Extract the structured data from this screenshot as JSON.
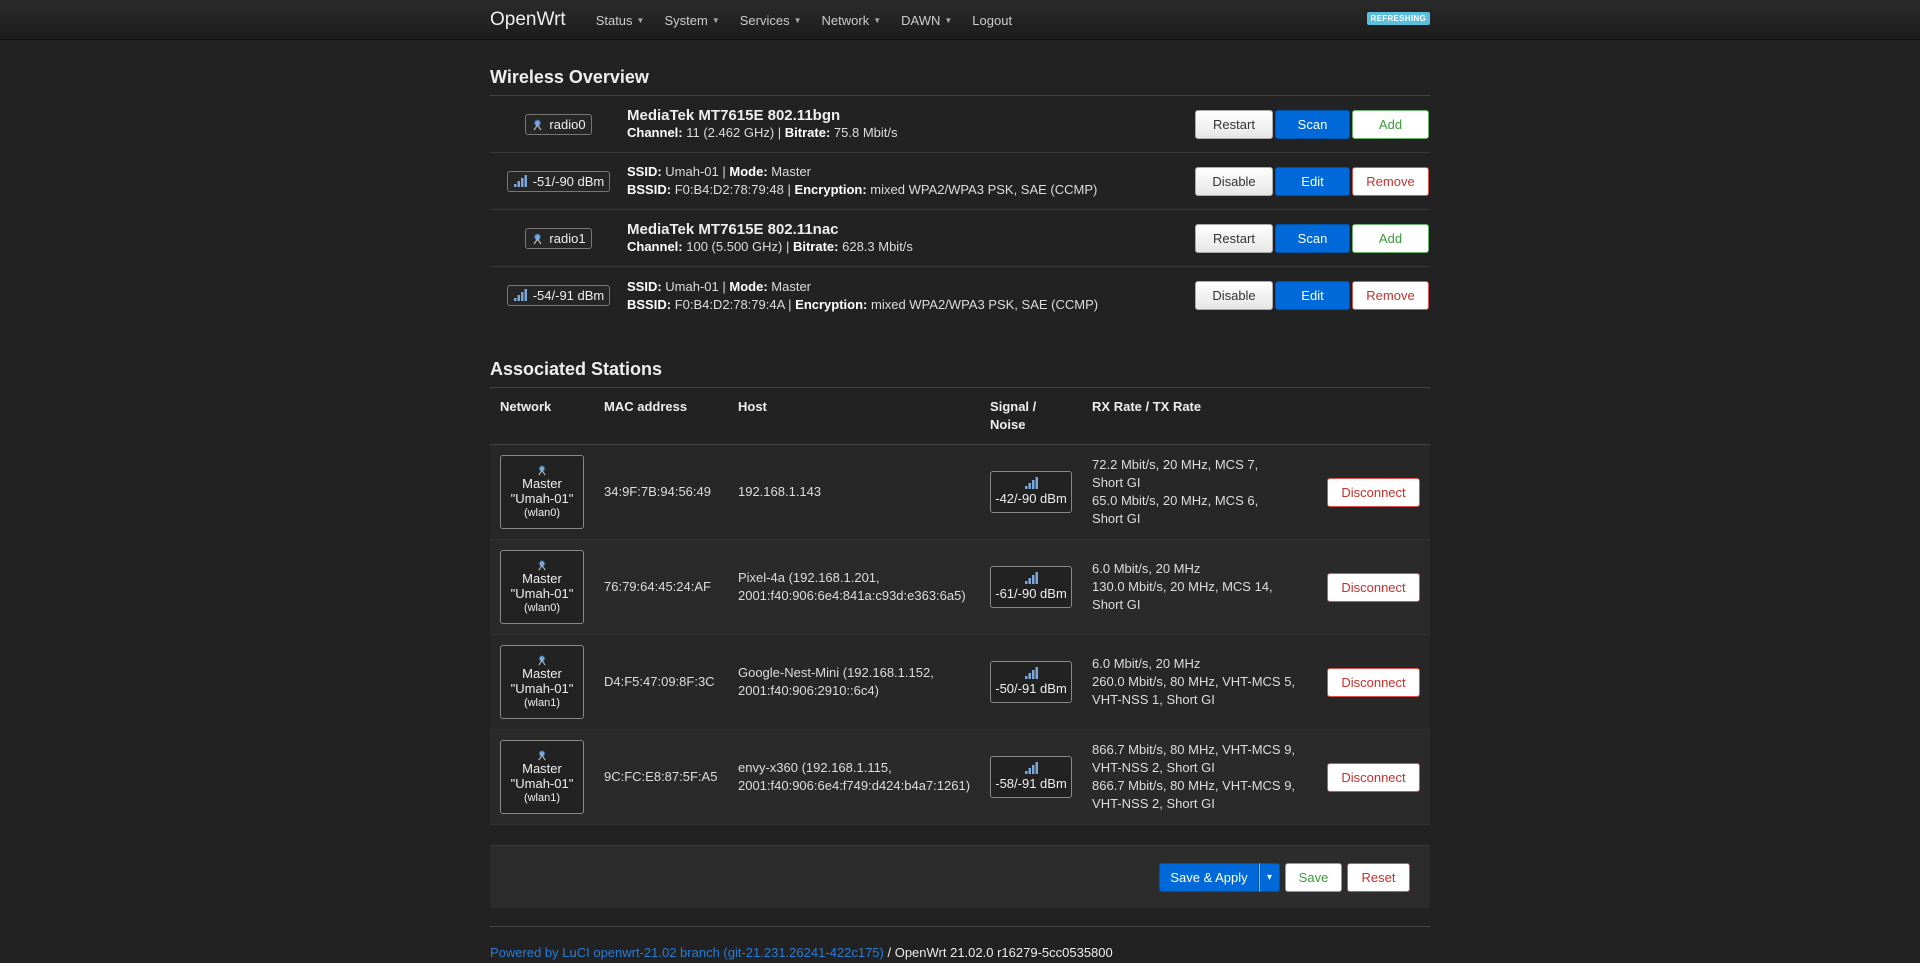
{
  "nav": {
    "brand": "OpenWrt",
    "menu": [
      {
        "label": "Status",
        "caret": true
      },
      {
        "label": "System",
        "caret": true
      },
      {
        "label": "Services",
        "caret": true
      },
      {
        "label": "Network",
        "caret": true
      },
      {
        "label": "DAWN",
        "caret": true
      },
      {
        "label": "Logout",
        "caret": false
      }
    ],
    "badge": "REFRESHING"
  },
  "wireless": {
    "title": "Wireless Overview",
    "radios": [
      {
        "device": {
          "chip": "radio0",
          "title": "MediaTek MT7615E 802.11bgn",
          "channel_label": "Channel:",
          "channel": "11 (2.462 GHz)",
          "sep": " | ",
          "bitrate_label": "Bitrate:",
          "bitrate": "75.8 Mbit/s",
          "buttons": [
            "Restart",
            "Scan",
            "Add"
          ]
        },
        "iface": {
          "chip": "-51/-90 dBm",
          "ssid_label": "SSID:",
          "ssid": "Umah-01",
          "mode_label": "Mode:",
          "mode": "Master",
          "bssid_label": "BSSID:",
          "bssid": "F0:B4:D2:78:79:48",
          "enc_label": "Encryption:",
          "enc": "mixed WPA2/WPA3 PSK, SAE (CCMP)",
          "buttons": [
            "Disable",
            "Edit",
            "Remove"
          ]
        }
      },
      {
        "device": {
          "chip": "radio1",
          "title": "MediaTek MT7615E 802.11nac",
          "channel_label": "Channel:",
          "channel": "100 (5.500 GHz)",
          "sep": " | ",
          "bitrate_label": "Bitrate:",
          "bitrate": "628.3 Mbit/s",
          "buttons": [
            "Restart",
            "Scan",
            "Add"
          ]
        },
        "iface": {
          "chip": "-54/-91 dBm",
          "ssid_label": "SSID:",
          "ssid": "Umah-01",
          "mode_label": "Mode:",
          "mode": "Master",
          "bssid_label": "BSSID:",
          "bssid": "F0:B4:D2:78:79:4A",
          "enc_label": "Encryption:",
          "enc": "mixed WPA2/WPA3 PSK, SAE (CCMP)",
          "buttons": [
            "Disable",
            "Edit",
            "Remove"
          ]
        }
      }
    ]
  },
  "stations": {
    "title": "Associated Stations",
    "columns": [
      "Network",
      "MAC address",
      "Host",
      "Signal /",
      "Noise",
      "RX Rate / TX Rate"
    ],
    "rows": [
      {
        "mode": "Master",
        "ssid": "\"Umah-01\"",
        "iface": "(wlan0)",
        "mac": "34:9F:7B:94:56:49",
        "host1": "192.168.1.143",
        "host2": "",
        "signal": "-42/-90 dBm",
        "rate": [
          "72.2 Mbit/s, 20 MHz, MCS 7,",
          "Short GI",
          "65.0 Mbit/s, 20 MHz, MCS 6,",
          "Short GI"
        ],
        "button": "Disconnect"
      },
      {
        "mode": "Master",
        "ssid": "\"Umah-01\"",
        "iface": "(wlan0)",
        "mac": "76:79:64:45:24:AF",
        "host1": "Pixel-4a (192.168.1.201,",
        "host2": "2001:f40:906:6e4:841a:c93d:e363:6a5)",
        "signal": "-61/-90 dBm",
        "rate": [
          "6.0 Mbit/s, 20 MHz",
          "130.0 Mbit/s, 20 MHz, MCS 14,",
          "Short GI"
        ],
        "button": "Disconnect"
      },
      {
        "mode": "Master",
        "ssid": "\"Umah-01\"",
        "iface": "(wlan1)",
        "mac": "D4:F5:47:09:8F:3C",
        "host1": "Google-Nest-Mini (192.168.1.152,",
        "host2": "2001:f40:906:2910::6c4)",
        "signal": "-50/-91 dBm",
        "rate": [
          "6.0 Mbit/s, 20 MHz",
          "260.0 Mbit/s, 80 MHz, VHT-MCS 5,",
          "VHT-NSS 1, Short GI"
        ],
        "button": "Disconnect"
      },
      {
        "mode": "Master",
        "ssid": "\"Umah-01\"",
        "iface": "(wlan1)",
        "mac": "9C:FC:E8:87:5F:A5",
        "host1": "envy-x360 (192.168.1.115,",
        "host2": "2001:f40:906:6e4:f749:d424:b4a7:1261)",
        "signal": "-58/-91 dBm",
        "rate": [
          "866.7 Mbit/s, 80 MHz, VHT-MCS 9,",
          "VHT-NSS 2, Short GI",
          "866.7 Mbit/s, 80 MHz, VHT-MCS 9,",
          "VHT-NSS 2, Short GI"
        ],
        "button": "Disconnect"
      }
    ]
  },
  "actions": {
    "save_apply": "Save & Apply",
    "dropdown": "▾",
    "save": "Save",
    "reset": "Reset"
  },
  "footer": {
    "link": "Powered by LuCI openwrt-21.02 branch (git-21.231.26241-422c175)",
    "version": " / OpenWrt 21.02.0 r16279-5cc0535800"
  },
  "colors": {
    "accent": "#0069d9",
    "badge": "#5bc0de",
    "link": "#2a7bd6",
    "danger": "#c9302c",
    "success": "#3a9a3a"
  }
}
